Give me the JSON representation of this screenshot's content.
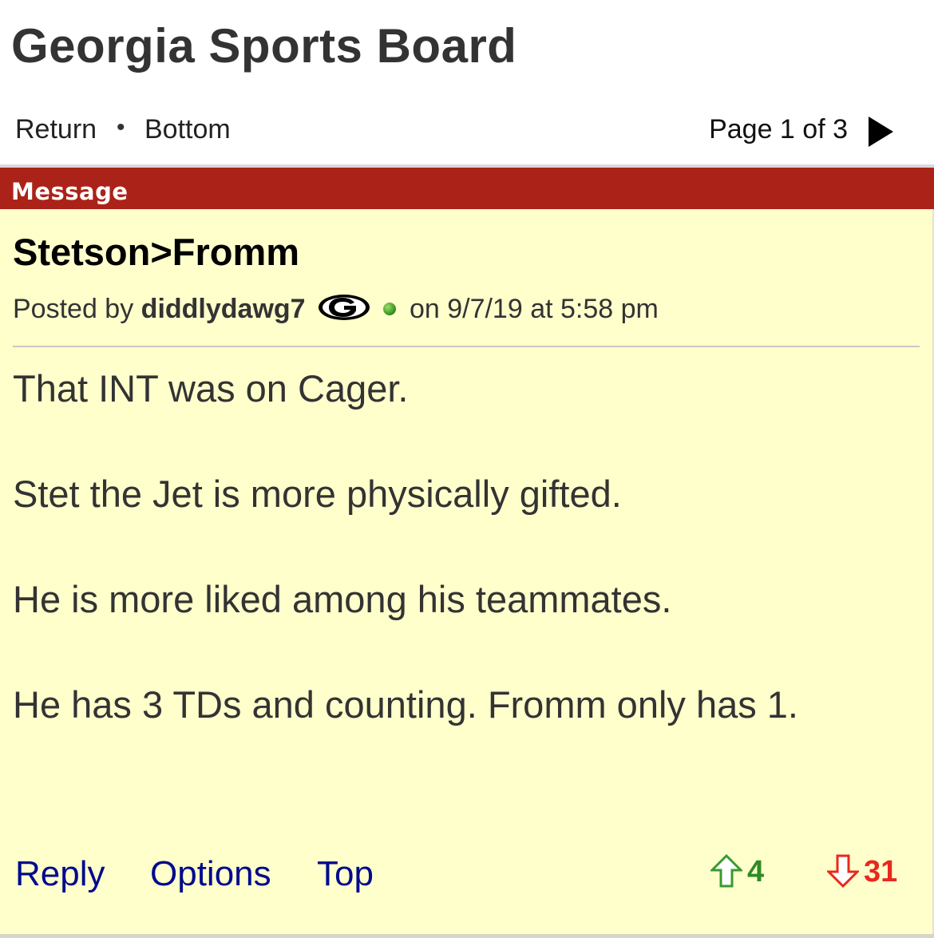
{
  "board": {
    "title": "Georgia Sports Board"
  },
  "nav": {
    "return_label": "Return",
    "separator": "•",
    "bottom_label": "Bottom",
    "page_label": "Page 1 of 3",
    "next_icon": "play-arrow-icon"
  },
  "section": {
    "header": "Message"
  },
  "post": {
    "title": "Stetson>Fromm",
    "posted_by_label": "Posted by",
    "author": "diddlydawg7",
    "team_icon": "georgia-g-logo-icon",
    "online_icon": "online-status-dot-icon",
    "date_text": "on 9/7/19 at 5:58 pm",
    "body": [
      "That INT was on Cager.",
      "Stet the Jet is more physically gifted.",
      "He is more liked among his teammates.",
      "He has 3 TDs and counting. Fromm only has 1."
    ]
  },
  "actions": {
    "reply_label": "Reply",
    "options_label": "Options",
    "top_label": "Top"
  },
  "votes": {
    "up_count": "4",
    "down_count": "31",
    "up_color": "#2e8b23",
    "down_color": "#e8291c"
  },
  "colors": {
    "message_bar": "#ab2318",
    "post_background": "#ffffcc",
    "link": "#000b8c"
  }
}
